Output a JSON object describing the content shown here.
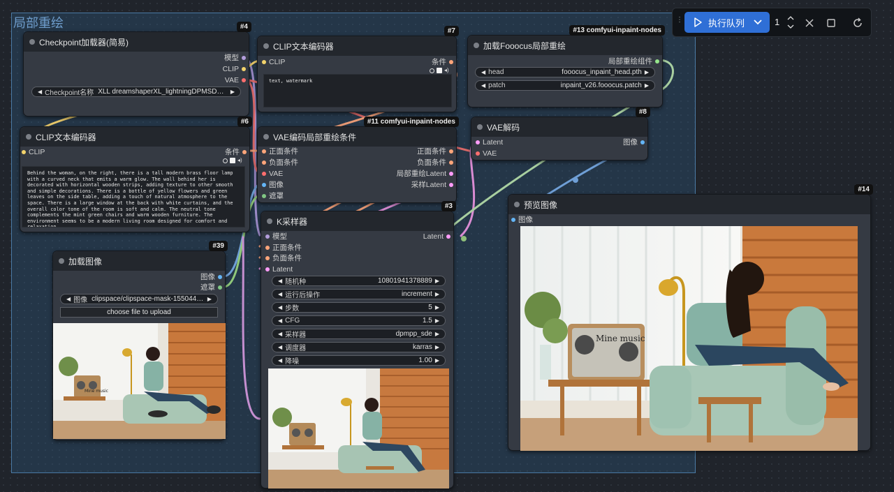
{
  "group": {
    "title": "局部重绘"
  },
  "toolbar": {
    "queue_label": "执行队列",
    "queue_count": "1"
  },
  "nodes": {
    "checkpoint": {
      "id": "#4",
      "title": "Checkpoint加载器(简易)",
      "outputs": [
        "模型",
        "CLIP",
        "VAE"
      ],
      "widget": {
        "label": "Checkpoint名称",
        "value": "XLL dreamshaperXL_lightningDPMSDE.s..."
      }
    },
    "clip_text_neg": {
      "id": "#7",
      "title": "CLIP文本编码器",
      "input": "CLIP",
      "output": "条件",
      "text": "text, watermark"
    },
    "fooocus_load": {
      "id": "#13 comfyui-inpaint-nodes",
      "title": "加载Fooocus局部重绘",
      "output": "局部重绘组件",
      "widgets": [
        {
          "label": "head",
          "value": "fooocus_inpaint_head.pth"
        },
        {
          "label": "patch",
          "value": "inpaint_v26.fooocus.patch"
        }
      ]
    },
    "clip_text_pos": {
      "id": "#6",
      "title": "CLIP文本编码器",
      "input": "CLIP",
      "output": "条件",
      "text": "Behind the woman, on the right, there is a tall modern brass floor lamp with a curved neck that emits a warm glow. The wall behind her is decorated with horizontal wooden strips, adding texture to other smooth and simple decorations. There is a bottle of yellow flowers and green leaves on the side table, adding a touch of natural atmosphere to the space. There is a large window at the back with white curtains, and the overall color tone of the room is soft and calm. The neutral tone complements the mint green chairs and warm wooden furniture. The environment seems to be a modern living room designed for comfort and relaxation."
    },
    "vae_encode_inpaint": {
      "id": "#11 comfyui-inpaint-nodes",
      "title": "VAE编码局部重绘条件",
      "inputs": [
        "正面条件",
        "负面条件",
        "VAE",
        "图像",
        "遮罩"
      ],
      "outputs": [
        "正面条件",
        "负面条件",
        "局部重绘Latent",
        "采样Latent"
      ]
    },
    "vae_decode": {
      "id": "#8",
      "title": "VAE解码",
      "inputs": [
        "Latent",
        "VAE"
      ],
      "output": "图像"
    },
    "ksampler": {
      "id": "#3",
      "title": "K采样器",
      "inputs": [
        "模型",
        "正面条件",
        "负面条件",
        "Latent"
      ],
      "output": "Latent",
      "widgets": [
        {
          "label": "随机种",
          "value": "10801941378889"
        },
        {
          "label": "运行后操作",
          "value": "increment"
        },
        {
          "label": "步数",
          "value": "5"
        },
        {
          "label": "CFG",
          "value": "1.5"
        },
        {
          "label": "采样器",
          "value": "dpmpp_sde"
        },
        {
          "label": "调度器",
          "value": "karras"
        },
        {
          "label": "降噪",
          "value": "1.00"
        }
      ]
    },
    "load_image": {
      "id": "#39",
      "title": "加载图像",
      "outputs": [
        "图像",
        "遮罩"
      ],
      "widget": {
        "label": "图像",
        "value": "clipspace/clipspace-mask-1550442..."
      },
      "upload_label": "choose file to upload",
      "image_text": "Mine music"
    },
    "preview": {
      "id": "#14",
      "title": "预览图像",
      "input": "图像",
      "image_text": "Mine music"
    }
  },
  "colors": {
    "clip": "#f3d36b",
    "vae": "#ff6e6e",
    "model": "#b39ddb",
    "conditioning": "#ffa57a",
    "latent": "#ff9cf9",
    "image": "#64b5f6",
    "mask": "#81c784",
    "inpaint": "#95e58b"
  }
}
